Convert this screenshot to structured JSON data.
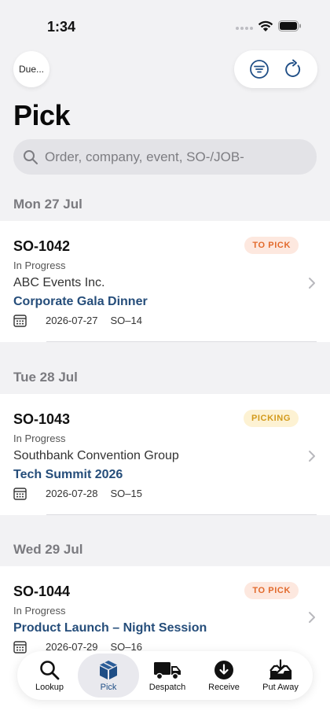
{
  "status_bar": {
    "time": "1:34"
  },
  "nav": {
    "due_label": "Due..."
  },
  "page": {
    "title": "Pick"
  },
  "search": {
    "placeholder": "Order, company, event, SO-/JOB-"
  },
  "sections": [
    {
      "header": "Mon 27 Jul",
      "orders": [
        {
          "id": "SO-1042",
          "badge": "TO PICK",
          "status": "In Progress",
          "company": "ABC Events Inc.",
          "event": "Corporate Gala Dinner",
          "date": "2026-07-27",
          "code": "SO–14"
        }
      ]
    },
    {
      "header": "Tue 28 Jul",
      "orders": [
        {
          "id": "SO-1043",
          "badge": "PICKING",
          "status": "In Progress",
          "company": "Southbank Convention Group",
          "event": "Tech Summit 2026",
          "date": "2026-07-28",
          "code": "SO–15"
        }
      ]
    },
    {
      "header": "Wed 29 Jul",
      "orders": [
        {
          "id": "SO-1044",
          "badge": "TO PICK",
          "status": "In Progress",
          "event": "Product Launch – Night Session",
          "date": "2026-07-29",
          "code": "SO–16"
        }
      ]
    }
  ],
  "tabs": [
    {
      "label": "Lookup",
      "icon": "magnifier-icon",
      "active": false
    },
    {
      "label": "Pick",
      "icon": "box-icon",
      "active": true
    },
    {
      "label": "Despatch",
      "icon": "truck-icon",
      "active": false
    },
    {
      "label": "Receive",
      "icon": "download-circle-icon",
      "active": false
    },
    {
      "label": "Put Away",
      "icon": "tray-in-icon",
      "active": false
    }
  ],
  "colors": {
    "accent": "#1f4e86",
    "event_link": "#254d7a",
    "badge_to_pick_bg": "#fde8df",
    "badge_to_pick_text": "#e26a2c",
    "badge_picking_bg": "#fdf2d3",
    "badge_picking_text": "#d39a1c",
    "background": "#f2f2f4"
  }
}
